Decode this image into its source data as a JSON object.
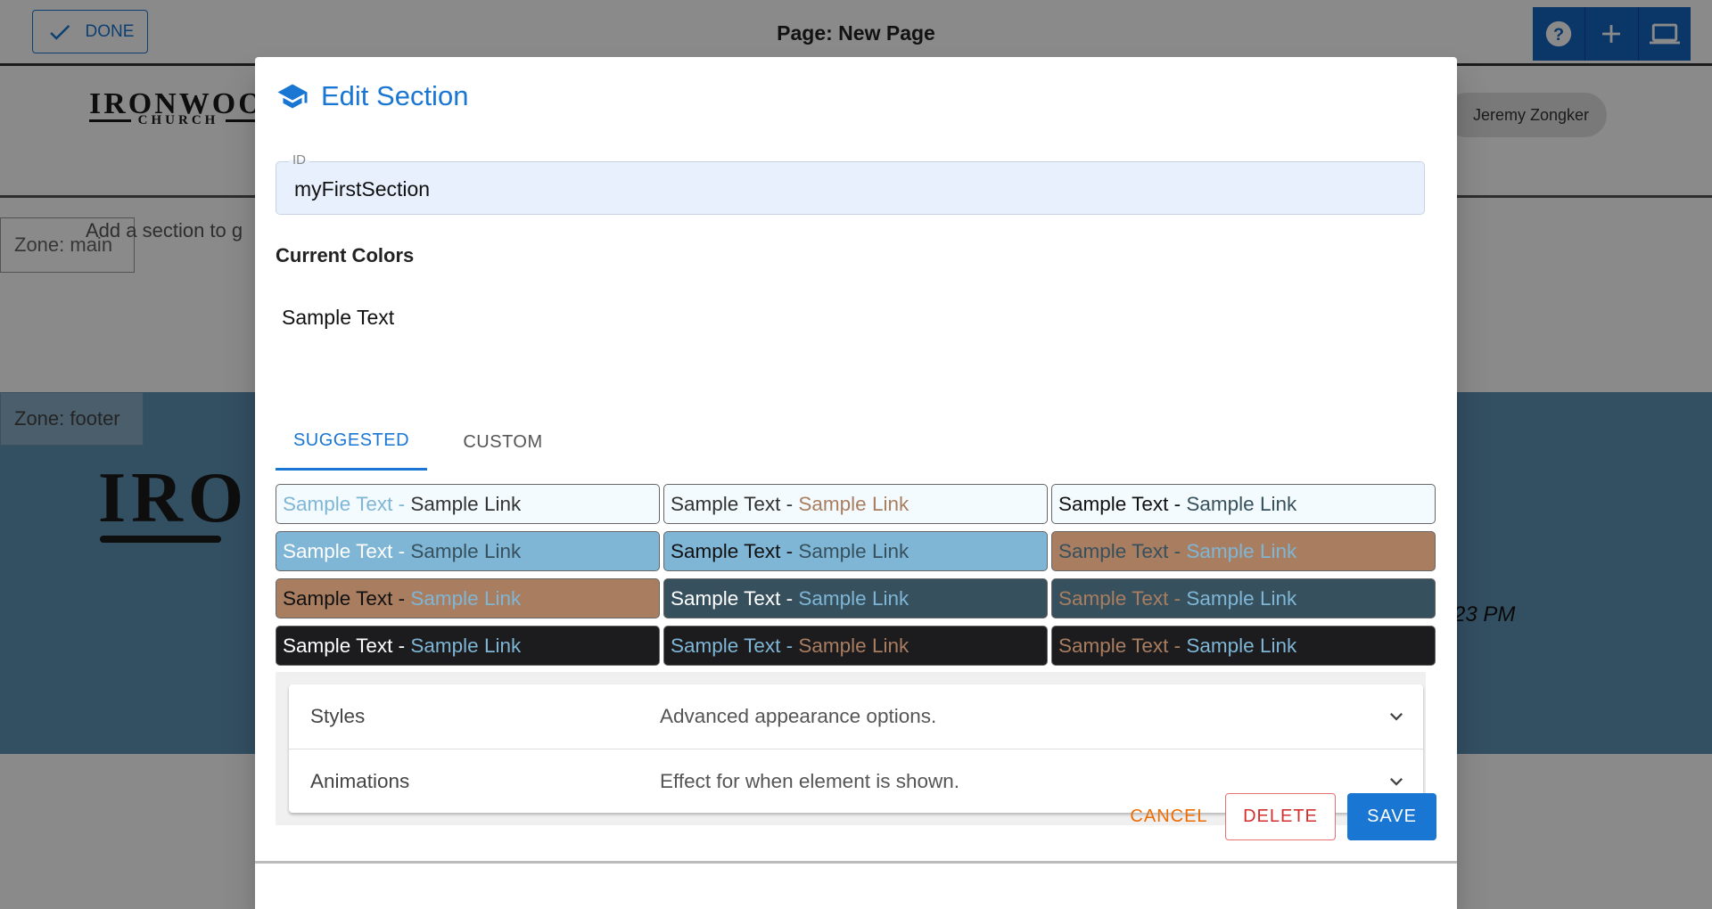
{
  "topbar": {
    "done_label": "DONE",
    "page_title": "Page: New Page",
    "actions": [
      "help-icon",
      "plus-icon",
      "laptop-icon"
    ]
  },
  "site": {
    "logo_top": "IRONWOOD",
    "logo_sub": "CHURCH",
    "user_name": "Jeremy Zongker",
    "zone_main_label": "Zone: main",
    "add_hint": "Add a section to g",
    "zone_footer_label": "Zone: footer",
    "footer_logo": "IRO",
    "footer_time": "23 PM"
  },
  "dialog": {
    "title": "Edit Section",
    "title_icon": "graduation-cap-icon",
    "id_label": "ID",
    "id_value": "myFirstSection",
    "current_colors_label": "Current Colors",
    "sample_preview": "Sample Text",
    "tabs": [
      {
        "label": "SUGGESTED",
        "active": true
      },
      {
        "label": "CUSTOM",
        "active": false
      }
    ],
    "swatches": [
      {
        "text": "Sample Text",
        "sep": " - ",
        "link": "Sample Link",
        "bg": "#f4fbfe",
        "text_color": "#7fb6d6",
        "link_color": "#333333"
      },
      {
        "text": "Sample Text",
        "sep": " - ",
        "link": "Sample Link",
        "bg": "#f4fbfe",
        "text_color": "#333333",
        "link_color": "#a97d60"
      },
      {
        "text": "Sample Text",
        "sep": " - ",
        "link": "Sample Link",
        "bg": "#f4fbfe",
        "text_color": "#111111",
        "link_color": "#36505d"
      },
      {
        "text": "Sample Text",
        "sep": " - ",
        "link": "Sample Link",
        "bg": "#7fb6d6",
        "text_color": "#ffffff",
        "link_color": "#36505d"
      },
      {
        "text": "Sample Text",
        "sep": " - ",
        "link": "Sample Link",
        "bg": "#7fb6d6",
        "text_color": "#111111",
        "link_color": "#36505d"
      },
      {
        "text": "Sample Text",
        "sep": " - ",
        "link": "Sample Link",
        "bg": "#a97d60",
        "text_color": "#36505d",
        "link_color": "#7fb6d6"
      },
      {
        "text": "Sample Text",
        "sep": " - ",
        "link": "Sample Link",
        "bg": "#a97d60",
        "text_color": "#111111",
        "link_color": "#7fb6d6"
      },
      {
        "text": "Sample Text",
        "sep": " - ",
        "link": "Sample Link",
        "bg": "#36505d",
        "text_color": "#ffffff",
        "link_color": "#7fb6d6"
      },
      {
        "text": "Sample Text",
        "sep": " - ",
        "link": "Sample Link",
        "bg": "#36505d",
        "text_color": "#a97d60",
        "link_color": "#7fb6d6"
      },
      {
        "text": "Sample Text",
        "sep": " - ",
        "link": "Sample Link",
        "bg": "#1c1c1e",
        "text_color": "#ffffff",
        "link_color": "#7fb6d6"
      },
      {
        "text": "Sample Text",
        "sep": " - ",
        "link": "Sample Link",
        "bg": "#1c1c1e",
        "text_color": "#7fb6d6",
        "link_color": "#a97d60"
      },
      {
        "text": "Sample Text",
        "sep": " - ",
        "link": "Sample Link",
        "bg": "#1c1c1e",
        "text_color": "#a97d60",
        "link_color": "#7fb6d6"
      }
    ],
    "accordion": [
      {
        "name": "Styles",
        "description": "Advanced appearance options."
      },
      {
        "name": "Animations",
        "description": "Effect for when element is shown."
      }
    ],
    "buttons": {
      "cancel": "CANCEL",
      "delete": "DELETE",
      "save": "SAVE"
    }
  },
  "colors": {
    "primary": "#1976d2",
    "cancel": "#ef6c00",
    "delete": "#d32f2f"
  }
}
